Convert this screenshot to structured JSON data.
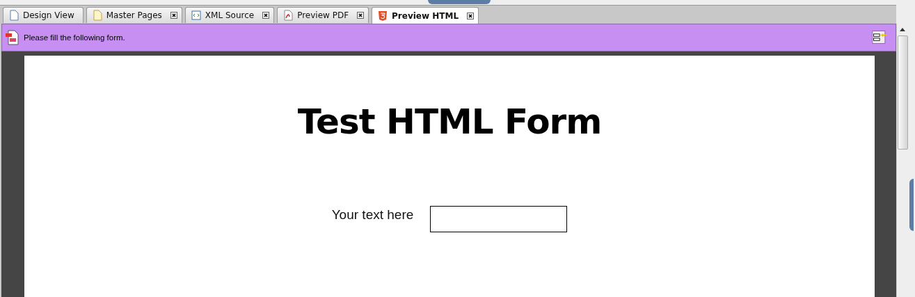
{
  "tabs": [
    {
      "label": "Design View",
      "selected": false,
      "closable": false
    },
    {
      "label": "Master Pages",
      "selected": false,
      "closable": true
    },
    {
      "label": "XML Source",
      "selected": false,
      "closable": true
    },
    {
      "label": "Preview PDF",
      "selected": false,
      "closable": true
    },
    {
      "label": "Preview HTML",
      "selected": true,
      "closable": true
    }
  ],
  "message_bar": {
    "text": "Please fill the following form."
  },
  "form": {
    "title": "Test HTML Form",
    "fields": [
      {
        "label": "Your text here"
      }
    ]
  }
}
